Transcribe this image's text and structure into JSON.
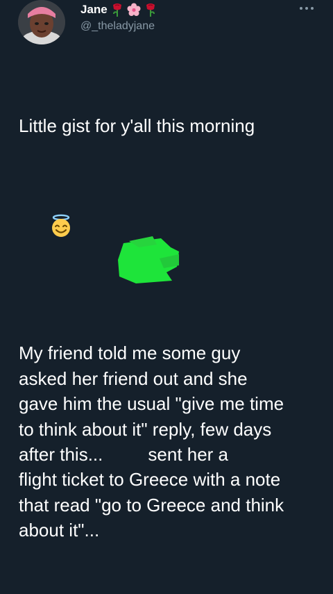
{
  "user": {
    "display_name": "Jane",
    "handle": "@_theladyjane"
  },
  "header_emojis": [
    "rose-emoji",
    "cherry-blossom-emoji",
    "rose-emoji"
  ],
  "tweet": {
    "line1": "Little gist for y'all this morning",
    "line2_emoji": "smiling-face-with-halo-emoji",
    "paragraph": "My friend told me some guy\nasked her friend out and she\ngave him the usual \"give me time\nto think about it\" reply, few days\nafter this...         sent her a\nflight ticket to Greece with a note\nthat read \"go to Greece and think\nabout it\"..."
  },
  "colors": {
    "background": "#15202b",
    "handle": "#8899a6",
    "censor": "#1ee43a"
  }
}
